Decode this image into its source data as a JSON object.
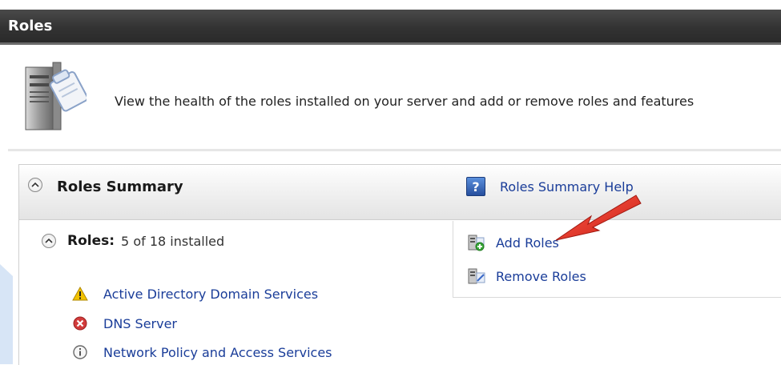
{
  "header": {
    "title": "Roles"
  },
  "description": "View the health of the roles installed on your server and add or remove roles and features",
  "summary": {
    "title": "Roles Summary",
    "help_link": "Roles Summary Help",
    "roles_label": "Roles:",
    "roles_count": "5 of 18 installed",
    "roles": [
      {
        "name": "Active Directory Domain Services",
        "status_icon": "warning-icon"
      },
      {
        "name": "DNS Server",
        "status_icon": "error-icon"
      },
      {
        "name": "Network Policy and Access Services",
        "status_icon": "info-icon"
      }
    ],
    "actions": {
      "add_roles": "Add Roles",
      "remove_roles": "Remove Roles"
    }
  },
  "colors": {
    "titlebar": "#333333",
    "link": "#1a3d99",
    "arrow": "#e02b20",
    "warning": "#f2c200",
    "error": "#d23b3b",
    "info": "#6a6a6a"
  }
}
